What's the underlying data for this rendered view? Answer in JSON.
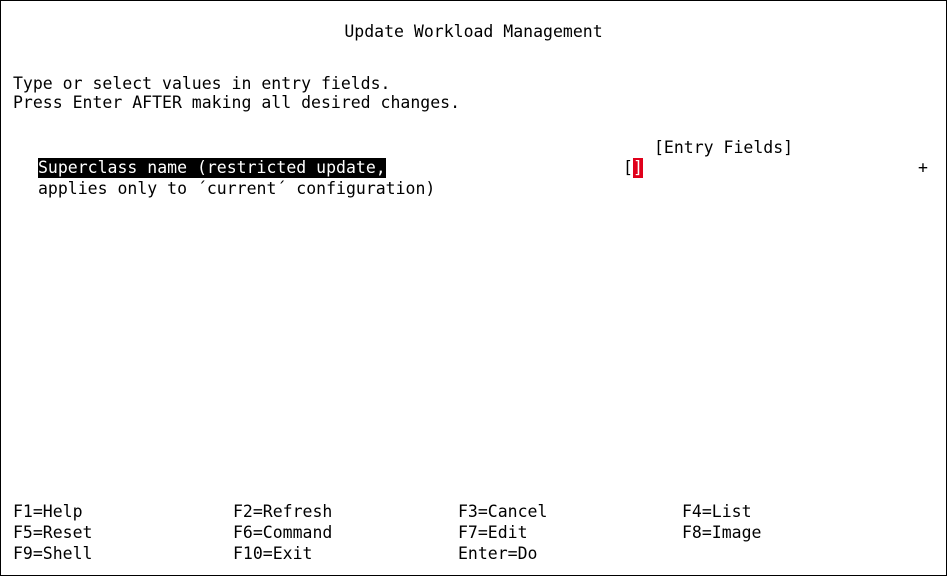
{
  "title": "Update Workload Management",
  "instructions": [
    "Type or select values in entry fields.",
    "Press Enter AFTER making all desired changes."
  ],
  "entry_fields_header": "[Entry Fields]",
  "field": {
    "label_line1": "Superclass name (restricted update,",
    "label_line2": "applies only to ´current´ configuration)",
    "value": "",
    "open_bracket": "[",
    "close_bracket": "]",
    "list_marker": "+"
  },
  "function_keys": {
    "f1": "F1=Help",
    "f2": "F2=Refresh",
    "f3": "F3=Cancel",
    "f4": "F4=List",
    "f5": "F5=Reset",
    "f6": "F6=Command",
    "f7": "F7=Edit",
    "f8": "F8=Image",
    "f9": "F9=Shell",
    "f10": "F10=Exit",
    "enter": "Enter=Do"
  },
  "colors": {
    "background": "#ffffff",
    "text": "#000000",
    "highlight_bg": "#000000",
    "highlight_text": "#ffffff",
    "cursor": "#e0001b"
  }
}
